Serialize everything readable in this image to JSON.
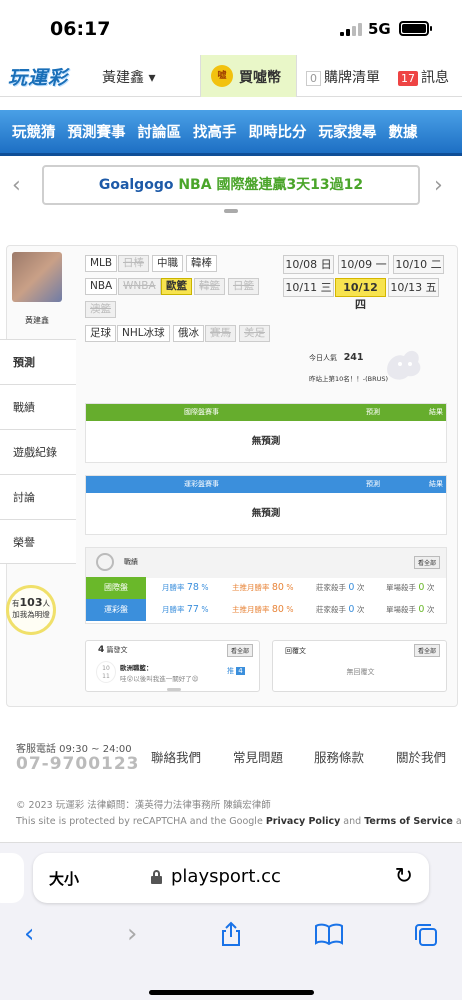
{
  "status": {
    "time": "06:17",
    "network": "5G"
  },
  "header": {
    "logo": "玩運彩",
    "user": "黃建鑫 ▾",
    "buy": "買噓幣",
    "coin_badge": "噓",
    "bet_count": "0",
    "bet_label": "購牌清單",
    "msg_count": "17",
    "msg_label": "訊息"
  },
  "nav": {
    "items": [
      "玩競猜",
      "預測賽事",
      "討論區",
      "找高手",
      "即時比分",
      "玩家搜尋",
      "數據"
    ]
  },
  "banner": {
    "part1": "Goalgogo",
    "part2": " NBA 國際盤連贏3天13過12",
    "left": "‹",
    "right": "›"
  },
  "profile": {
    "name": "黃建鑫"
  },
  "side_tabs": [
    "預測",
    "戰績",
    "遊戲紀錄",
    "討論",
    "榮譽"
  ],
  "popularity": {
    "prefix": "有",
    "count": "103",
    "suffix": "人",
    "line2": "加我為明燈"
  },
  "leagues": [
    [
      "MLB",
      "日棒",
      "中職",
      "韓棒"
    ],
    [
      "NBA",
      "WNBA",
      "歐籃",
      "韓籃",
      "日籃",
      "澳籃"
    ],
    [
      "足球",
      "NHL冰球",
      "俄冰",
      "賽馬",
      "美足"
    ]
  ],
  "dates": [
    "10/08 日",
    "10/09 一",
    "10/10 二",
    "10/11 三",
    "10/12 四",
    "10/13 五"
  ],
  "today": {
    "label": "今日人氣",
    "count": "241",
    "rank": "昨站上第10名！！-(BRUS)"
  },
  "intl_table": {
    "h1": "國際盤賽事",
    "h2": "預測",
    "h3": "結果",
    "empty": "無預測"
  },
  "lottery_table": {
    "h1": "運彩盤賽事",
    "h2": "預測",
    "h3": "結果",
    "empty": "無預測"
  },
  "record": {
    "title": "戰績",
    "all": "看全部",
    "rows": [
      {
        "tag": "國際盤",
        "a": "月勝率",
        "av": "78",
        "ap": "%",
        "b": "主推月勝率",
        "bv": "80",
        "bp": "%",
        "c": "莊家殺手",
        "cv": "0",
        "cu": "次",
        "d": "單場殺手",
        "dv": "0",
        "du": "次"
      },
      {
        "tag": "運彩盤",
        "a": "月勝率",
        "av": "77",
        "ap": "%",
        "b": "主推月勝率",
        "bv": "80",
        "bp": "%",
        "c": "莊家殺手",
        "cv": "0",
        "cu": "次",
        "d": "單場殺手",
        "dv": "0",
        "du": "次"
      }
    ]
  },
  "posts": {
    "count": "4",
    "label": "篇發文",
    "all": "看全部",
    "date_m": "10",
    "date_d": "11",
    "title": "歐洲職籃：",
    "body": "哇😲以後叫我進一關好了😫",
    "push": "推",
    "push_n": "4"
  },
  "replies": {
    "label": "回覆文",
    "all": "看全部",
    "empty": "無回覆文"
  },
  "footer": {
    "svc": "客服電話 09:30 ~ 24:00",
    "phone": "07-9700123",
    "links": [
      "聯絡我們",
      "常見問題",
      "服務條款",
      "關於我們"
    ],
    "copy": "© 2023 玩運彩 法律顧問：漢英得力法律事務所 陳鎮宏律師",
    "recap1": "This site is protected by reCAPTCHA and the Google ",
    "pp": "Privacy Policy",
    "and": " and ",
    "tos": "Terms of Service",
    "apply": " apply."
  },
  "safari": {
    "aa": "大小",
    "url": "playsport.cc"
  },
  "colors": {
    "nav": "#2a85d8",
    "green": "#6ab82a",
    "blue": "#3a8fdc",
    "accent_yellow": "#f7e34f"
  }
}
